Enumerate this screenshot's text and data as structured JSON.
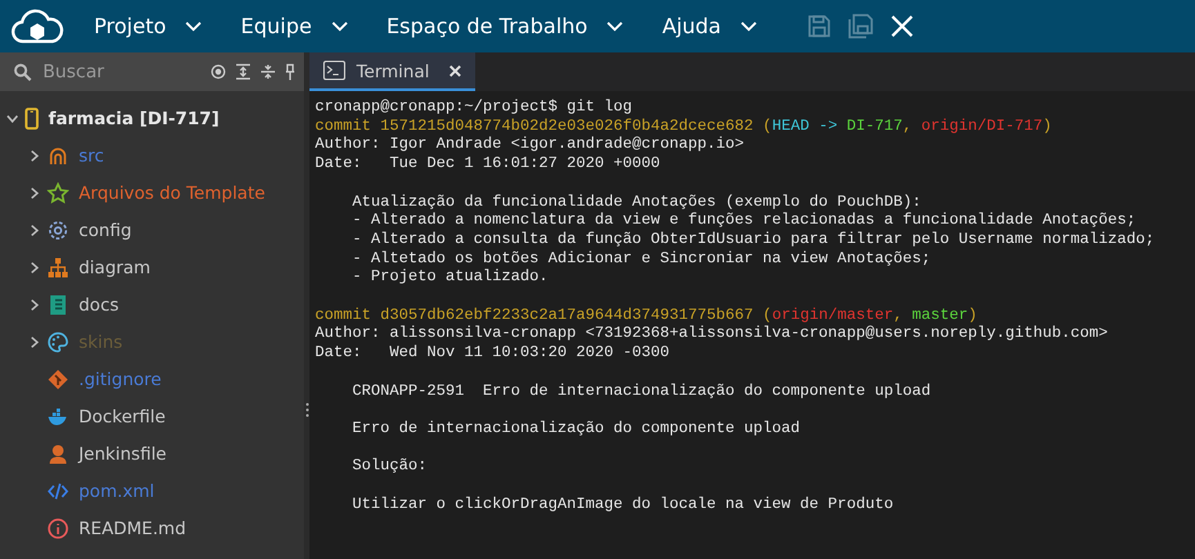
{
  "menu": [
    {
      "label": "Projeto"
    },
    {
      "label": "Equipe"
    },
    {
      "label": "Espaço de Trabalho"
    },
    {
      "label": "Ajuda"
    }
  ],
  "toolbar": [
    {
      "kind": "save",
      "disabled": true
    },
    {
      "kind": "save-all",
      "disabled": true
    },
    {
      "kind": "close",
      "disabled": false
    }
  ],
  "search": {
    "placeholder": "Buscar"
  },
  "tree": {
    "label": "farmacia [DI-717]",
    "expanded": true,
    "children": [
      {
        "label": "src",
        "kind": "source",
        "folder": true,
        "color": "#4a7bd6"
      },
      {
        "label": "Arquivos do Template",
        "kind": "star",
        "folder": true,
        "color": "#e0622e"
      },
      {
        "label": "config",
        "kind": "gear",
        "folder": true,
        "color": "#c8c8c8"
      },
      {
        "label": "diagram",
        "kind": "diagram",
        "folder": true,
        "color": "#c8c8c8"
      },
      {
        "label": "docs",
        "kind": "book",
        "folder": true,
        "color": "#c8c8c8"
      },
      {
        "label": "skins",
        "kind": "palette",
        "folder": true,
        "color": "#6b5d3a"
      },
      {
        "label": ".gitignore",
        "kind": "git",
        "folder": false,
        "color": "#4a7bd6"
      },
      {
        "label": "Dockerfile",
        "kind": "docker",
        "folder": false,
        "color": "#c8c8c8"
      },
      {
        "label": "Jenkinsfile",
        "kind": "jenkins",
        "folder": false,
        "color": "#c8c8c8"
      },
      {
        "label": "pom.xml",
        "kind": "code",
        "folder": false,
        "color": "#4a7bd6"
      },
      {
        "label": "README.md",
        "kind": "info",
        "folder": false,
        "color": "#c8c8c8"
      }
    ]
  },
  "tabs": [
    {
      "label": "Terminal",
      "selected": true
    }
  ],
  "terminal_blocks": [
    [
      [
        {
          "text": "cronapp@cronapp:~/project$ git log",
          "kind": "plain"
        }
      ],
      [
        {
          "text": "commit 1571215d048774b02d2e03e026f0b4a2dcece682 (",
          "kind": "commit"
        },
        {
          "text": "HEAD -> ",
          "kind": "head"
        },
        {
          "text": "DI-717",
          "kind": "branch"
        },
        {
          "text": ", ",
          "kind": "commit"
        },
        {
          "text": "origin/DI-717",
          "kind": "remote"
        },
        {
          "text": ")",
          "kind": "commit"
        }
      ],
      [
        {
          "text": "Author: Igor Andrade <igor.andrade@cronapp.io>",
          "kind": "plain"
        }
      ],
      [
        {
          "text": "Date:   Tue Dec 1 16:01:27 2020 +0000",
          "kind": "plain"
        }
      ]
    ],
    [
      [
        {
          "text": "    Atualização da funcionalidade Anotações (exemplo do PouchDB):",
          "kind": "plain"
        }
      ],
      [
        {
          "text": "    - Alterado a nomenclatura da view e funções relacionadas a funcionalidade Anotações;",
          "kind": "plain"
        }
      ],
      [
        {
          "text": "    - Alterado a consulta da função ObterIdUsuario para filtrar pelo Username normalizado;",
          "kind": "plain"
        }
      ],
      [
        {
          "text": "    - Altetado os botões Adicionar e Sincroniar na view Anotações;",
          "kind": "plain"
        }
      ],
      [
        {
          "text": "    - Projeto atualizado.",
          "kind": "plain"
        }
      ]
    ],
    [
      [
        {
          "text": "commit d3057db62ebf2233c2a17a9644d374931775b667 (",
          "kind": "commit"
        },
        {
          "text": "origin/master",
          "kind": "remote"
        },
        {
          "text": ", ",
          "kind": "commit"
        },
        {
          "text": "master",
          "kind": "branch"
        },
        {
          "text": ")",
          "kind": "commit"
        }
      ],
      [
        {
          "text": "Author: alissonsilva-cronapp <73192368+alissonsilva-cronapp@users.noreply.github.com>",
          "kind": "plain"
        }
      ],
      [
        {
          "text": "Date:   Wed Nov 11 10:03:20 2020 -0300",
          "kind": "plain"
        }
      ]
    ],
    [
      [
        {
          "text": "    CRONAPP-2591  Erro de internacionalização do componente upload",
          "kind": "plain"
        }
      ]
    ],
    [
      [
        {
          "text": "    Erro de internacionalização do componente upload",
          "kind": "plain"
        }
      ]
    ],
    [
      [
        {
          "text": "    Solução:",
          "kind": "plain"
        }
      ]
    ],
    [
      [
        {
          "text": "    Utilizar o clickOrDragAnImage do locale na view de Produto",
          "kind": "plain"
        }
      ]
    ]
  ]
}
